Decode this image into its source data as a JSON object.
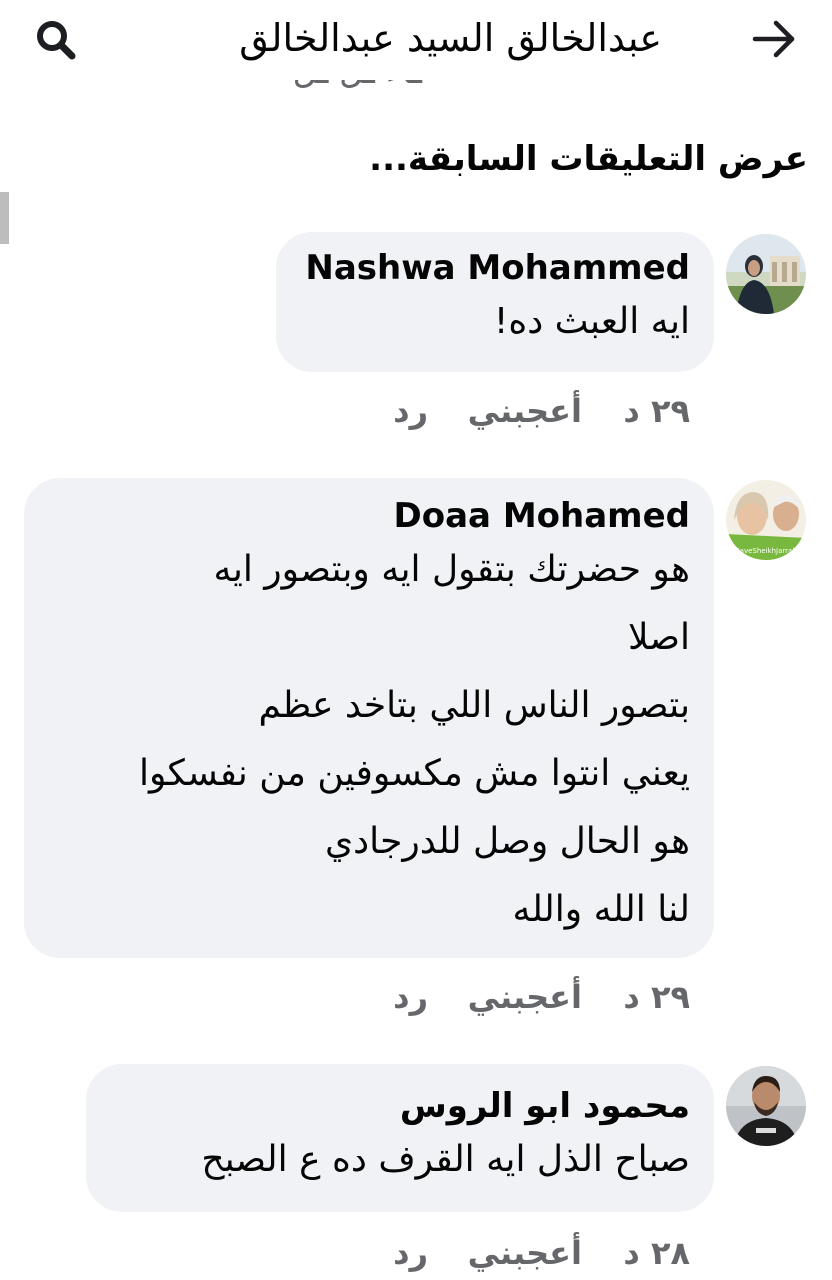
{
  "header": {
    "title": "عبدالخالق السيد عبدالخالق",
    "back_icon": "arrow-right-icon",
    "search_icon": "search-icon"
  },
  "cut_text": "ـاء ـل ـل",
  "previous_comments_label": "عرض التعليقات السابقة...",
  "comments": [
    {
      "author": "Nashwa Mohammed",
      "lines": [
        "ايه العبث ده!"
      ],
      "time": "٢٩ د",
      "like_label": "أعجبني",
      "reply_label": "رد"
    },
    {
      "author": "Doaa Mohamed",
      "lines": [
        "هو حضرتك بتقول ايه وبتصور ايه",
        "اصلا",
        "بتصور الناس اللي بتاخد عظم",
        "يعني انتوا مش مكسوفين من نفسكوا",
        "هو الحال وصل للدرجادي",
        "لنا الله والله"
      ],
      "time": "٢٩ د",
      "like_label": "أعجبني",
      "reply_label": "رد",
      "avatar_caption": "SaveSheikhJarrah"
    },
    {
      "author": "محمود ابو الروس",
      "lines": [
        "صباح الذل ايه القرف ده ع الصبح"
      ],
      "time": "٢٨ د",
      "like_label": "أعجبني",
      "reply_label": "رد"
    }
  ],
  "colors": {
    "bubble": "#f0f2f5",
    "meta_text": "#65676b",
    "text": "#050505"
  }
}
